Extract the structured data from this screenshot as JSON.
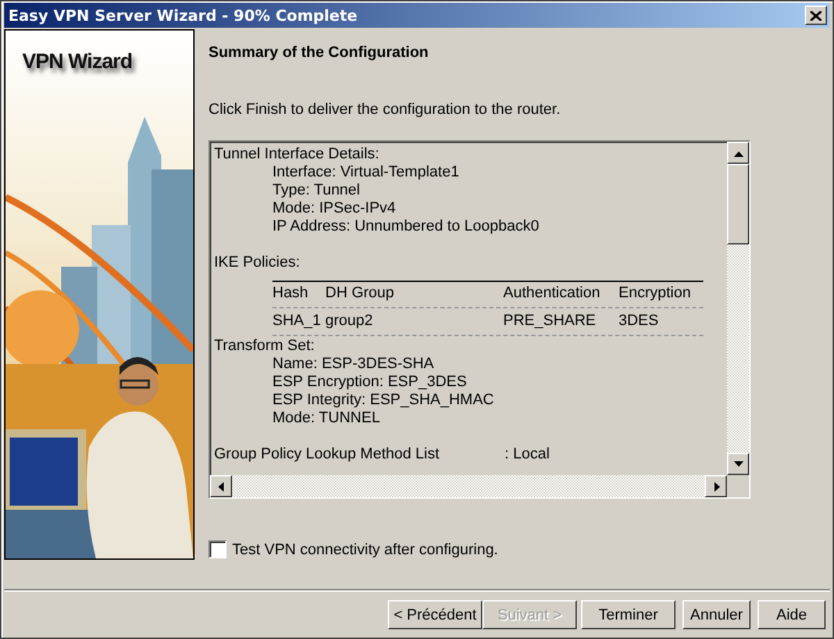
{
  "window": {
    "title": "Easy VPN Server Wizard - 90% Complete"
  },
  "wizard_panel": {
    "title": "VPN Wizard"
  },
  "heading": "Summary of the Configuration",
  "instruction": "Click Finish to deliver the configuration to the router.",
  "summary": [
    {
      "kind": "section",
      "text": "Tunnel Interface Details:"
    },
    {
      "kind": "detail",
      "text": "Interface: Virtual-Template1"
    },
    {
      "kind": "detail",
      "text": "Type: Tunnel"
    },
    {
      "kind": "detail",
      "text": "Mode: IPSec-IPv4"
    },
    {
      "kind": "detail",
      "text": "IP Address: Unnumbered to Loopback0"
    },
    {
      "kind": "gap"
    },
    {
      "kind": "section",
      "text": "IKE Policies:"
    },
    {
      "kind": "table",
      "columns": [
        "Hash",
        "DH Group",
        "Authentication",
        "Encryption"
      ],
      "rows": [
        [
          "SHA_1",
          "group2",
          "PRE_SHARE",
          "3DES"
        ]
      ]
    },
    {
      "kind": "section",
      "text": "Transform Set:"
    },
    {
      "kind": "detail",
      "text": "Name: ESP-3DES-SHA"
    },
    {
      "kind": "detail",
      "text": "ESP Encryption: ESP_3DES"
    },
    {
      "kind": "detail",
      "text": "ESP Integrity: ESP_SHA_HMAC"
    },
    {
      "kind": "detail",
      "text": "Mode: TUNNEL"
    },
    {
      "kind": "gap"
    },
    {
      "kind": "pair",
      "label": "Group Policy Lookup Method List",
      "value": ": Local"
    }
  ],
  "test_checkbox": {
    "label": "Test VPN connectivity after configuring.",
    "checked": false
  },
  "buttons": [
    {
      "label": "< Précédent",
      "disabled": false
    },
    {
      "label": "Suivant >",
      "disabled": true
    },
    {
      "label": "Terminer",
      "disabled": false
    },
    {
      "label": "Annuler",
      "disabled": false
    },
    {
      "label": "Aide",
      "disabled": false
    }
  ]
}
